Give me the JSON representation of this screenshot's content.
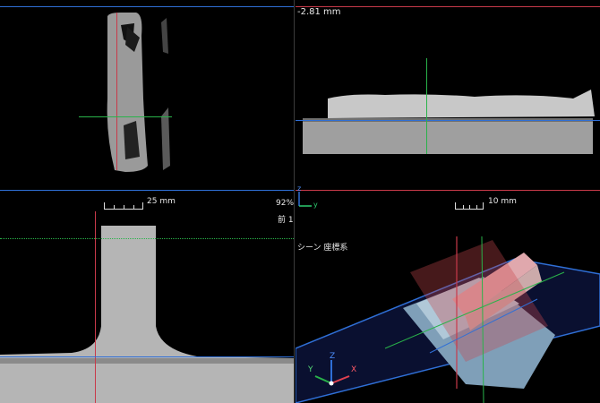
{
  "panes": {
    "top_right": {
      "offset_label": "-2.81 mm"
    },
    "bottom_right": {
      "label": "シーン 座標系"
    }
  },
  "scalebars": {
    "left": "25 mm",
    "right": "10 mm"
  },
  "center": {
    "zoom": "92%",
    "view": "前 1"
  },
  "axes": {
    "center_z": "z",
    "center_y": "y",
    "triad_x": "X",
    "triad_y": "Y",
    "triad_z": "Z"
  },
  "colors": {
    "blue": "#2f6fd6",
    "red": "#c83a4a",
    "green": "#29b34a",
    "green_axis": "#2ecc71",
    "background": "#000000"
  }
}
